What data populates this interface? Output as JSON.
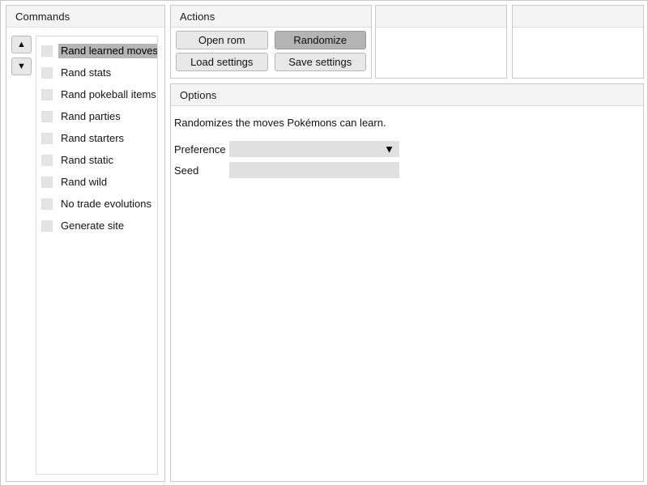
{
  "commands": {
    "title": "Commands",
    "move_up_icon": "triangle-up-icon",
    "move_up_glyph": "▲",
    "move_down_icon": "triangle-down-icon",
    "move_down_glyph": "▼",
    "items": [
      {
        "label": "Rand learned moves",
        "checked": false,
        "selected": true
      },
      {
        "label": "Rand stats",
        "checked": false,
        "selected": false
      },
      {
        "label": "Rand pokeball items",
        "checked": false,
        "selected": false
      },
      {
        "label": "Rand parties",
        "checked": false,
        "selected": false
      },
      {
        "label": "Rand starters",
        "checked": false,
        "selected": false
      },
      {
        "label": "Rand static",
        "checked": false,
        "selected": false
      },
      {
        "label": "Rand wild",
        "checked": false,
        "selected": false
      },
      {
        "label": "No trade evolutions",
        "checked": false,
        "selected": false
      },
      {
        "label": "Generate site",
        "checked": false,
        "selected": false
      }
    ]
  },
  "actions": {
    "title": "Actions",
    "open_rom_label": "Open rom",
    "randomize_label": "Randomize",
    "load_settings_label": "Load settings",
    "save_settings_label": "Save settings"
  },
  "blank_panels": {
    "panel_1_title": "",
    "panel_2_title": ""
  },
  "options": {
    "title": "Options",
    "description": "Randomizes the moves Pokémons can learn.",
    "preference_label": "Preference",
    "preference_value": "",
    "preference_arrow_glyph": "▼",
    "seed_label": "Seed",
    "seed_value": ""
  },
  "colors": {
    "window_bg": "#ffffff",
    "panel_border": "#c9c9c9",
    "header_bg": "#f4f4f4",
    "button_bg": "#e8e8e8",
    "button_active_bg": "#b4b4b4",
    "selection_bg": "#b5b5b5",
    "input_bg": "#e0e0e0",
    "checkbox_bg": "#e4e4e4",
    "text": "#121212"
  }
}
